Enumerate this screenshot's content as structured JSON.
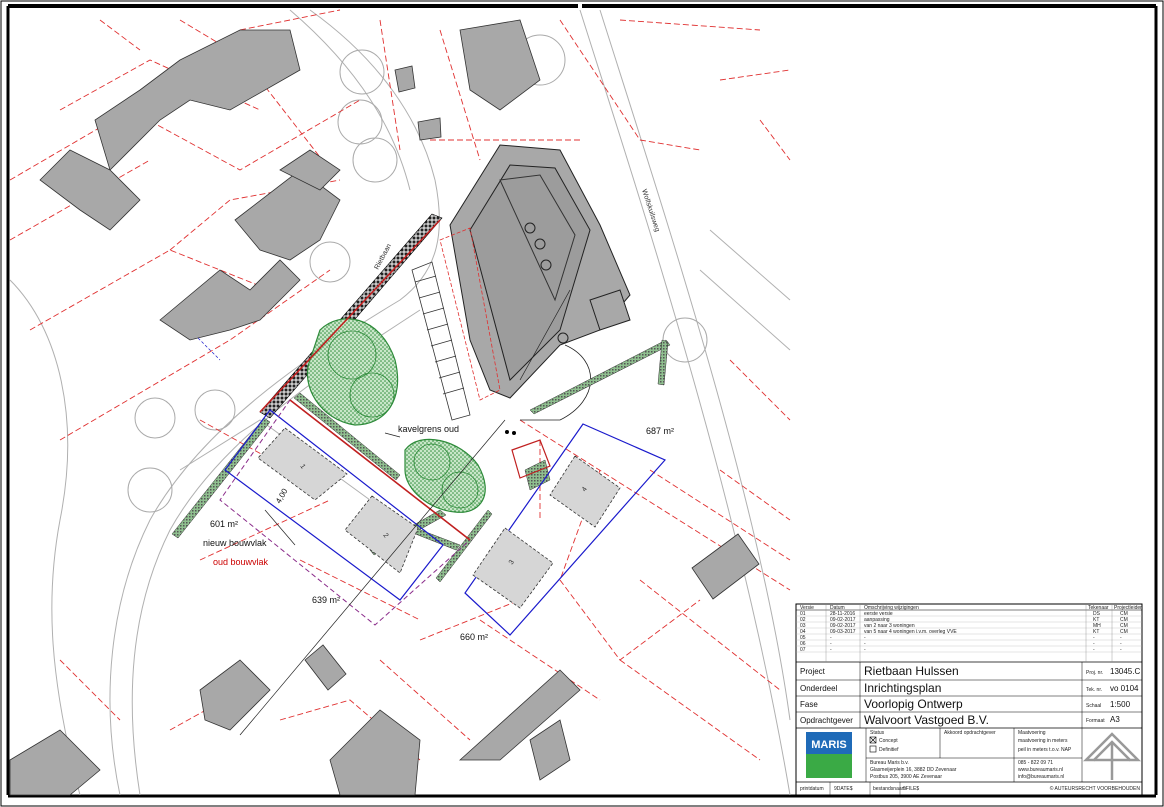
{
  "streets": {
    "rietbaan": "Rietbaan",
    "wolfskuilsweg": "Wolfskuilsweg"
  },
  "plan_labels": {
    "kavelgrens_oud": "kavelgrens oud",
    "nieuw_bouwvlak": "nieuw bouwvlak",
    "oud_bouwvlak": "oud bouwvlak",
    "dimension": "4,00"
  },
  "areas": [
    "601 m²",
    "639 m²",
    "660 m²",
    "687 m²"
  ],
  "lots": [
    "1",
    "2",
    "3",
    "4"
  ],
  "revisions": {
    "headers": [
      "Versie",
      "Datum",
      "Omschrijving wijzigingen",
      "Tekenaar",
      "Projectleider"
    ],
    "rows": [
      [
        "01",
        "28-11-2016",
        "eerste versie",
        "DS",
        "CM"
      ],
      [
        "02",
        "09-02-2017",
        "aanpassing",
        "KT",
        "CM"
      ],
      [
        "03",
        "09-02-2017",
        "van 2 naar 3 woningen",
        "MH",
        "CM"
      ],
      [
        "04",
        "09-03-2017",
        "van 5 naar 4 woningen i.v.m. overleg VVE",
        "KT",
        "CM"
      ],
      [
        "05",
        "-",
        "-",
        "-",
        "-"
      ],
      [
        "06",
        "-",
        "-",
        "-",
        "-"
      ],
      [
        "07",
        "-",
        "-",
        "-",
        "-"
      ]
    ]
  },
  "title_block": {
    "project_label": "Project",
    "project_value": "Rietbaan Hulssen",
    "onderdeel_label": "Onderdeel",
    "onderdeel_value": "Inrichtingsplan",
    "fase_label": "Fase",
    "fase_value": "Voorlopig Ontwerp",
    "opdrachtgever_label": "Opdrachtgever",
    "opdrachtgever_value": "Walvoort Vastgoed B.V.",
    "projnr_label": "Proj. nr.",
    "projnr_value": "13045.C",
    "teknr_label": "Tek. nr.",
    "teknr_value": "vo 0104",
    "schaal_label": "Schaal",
    "schaal_value": "1:500",
    "formaat_label": "Formaat",
    "formaat_value": "A3",
    "status_label": "Status",
    "status_concept": "Concept",
    "status_definitief": "Definitief",
    "akkoord_label": "Akkoord opdrachtgever",
    "maatvoering_label": "Maatvoering",
    "maatvoering_1": "maatvoering in meters",
    "maatvoering_2": "peil in meters t.o.v. NAP",
    "company_line1": "Bureau Maris b.v.",
    "company_line2": "Glasmeijerplein 16, 3882 DD Zevenaar",
    "company_line3": "Postbus 205, 3900 AE Zevenaar",
    "contact_line1": "085 - 822 09 71",
    "contact_line2": "www.bureaumaris.nl",
    "contact_line3": "info@bureaumaris.nl",
    "logo_text": "MARIS",
    "footer_left": "printdatum",
    "footer_date": "9DATE$",
    "footer_mid": "bestandsnaam",
    "footer_file": "9FILE$",
    "footer_right": "© AUTEURSRECHT VOORBEHOUDEN"
  }
}
